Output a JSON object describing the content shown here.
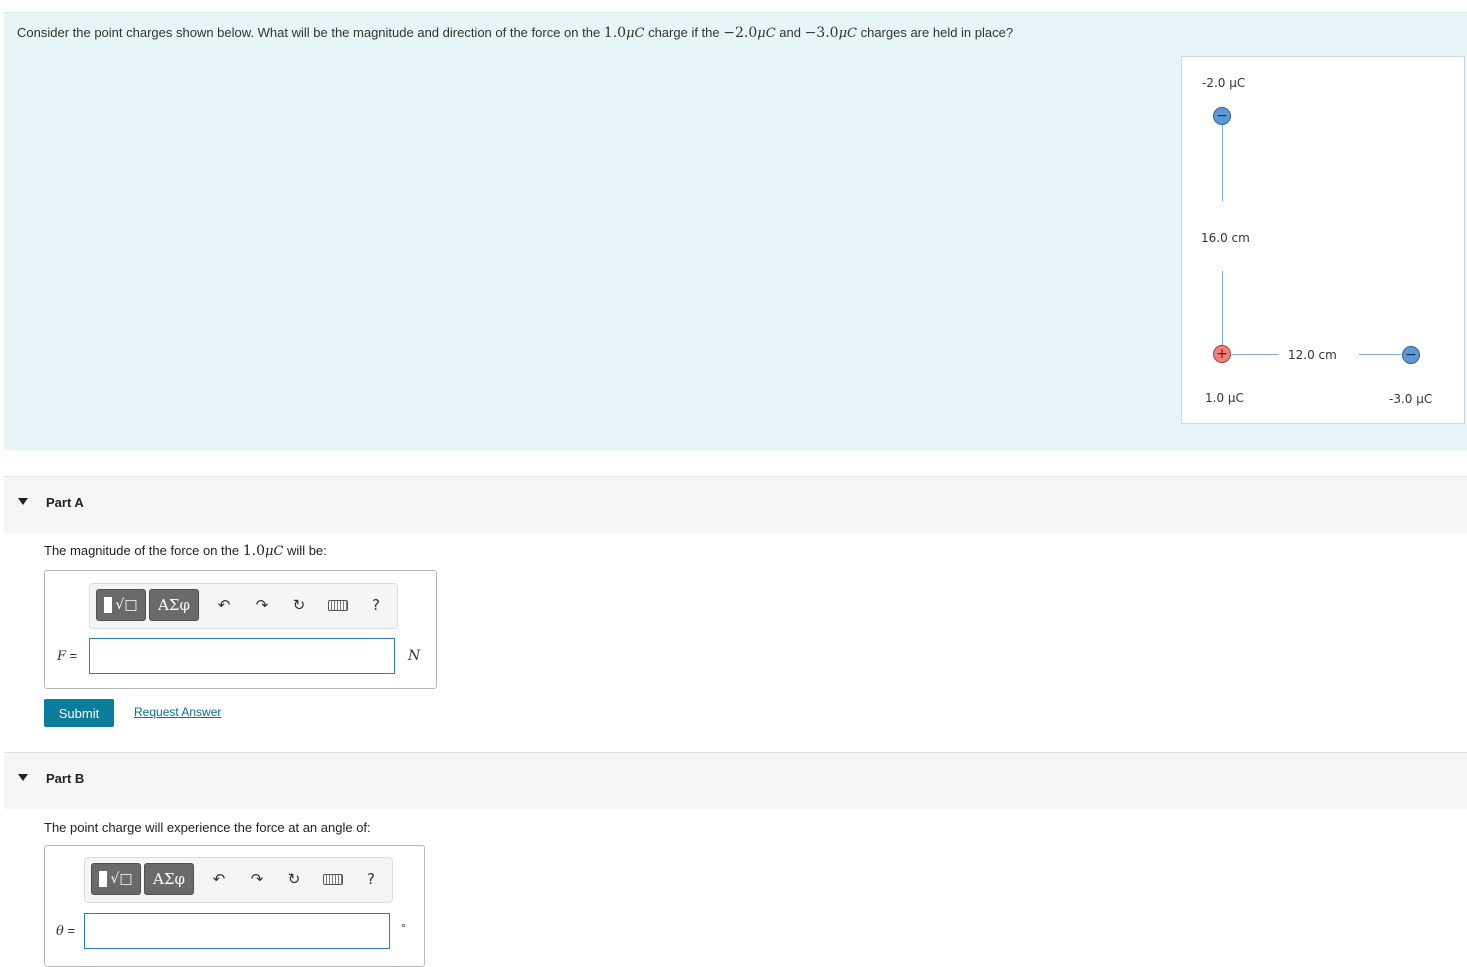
{
  "question": {
    "p1": "Consider the point charges shown below. What will be the magnitude and direction of the force on the ",
    "m1": "1.0",
    "m1u": "μC",
    "p2": " charge if the ",
    "m2": "−2.0",
    "m2u": "μC",
    "p3": " and ",
    "m3": "−3.0",
    "m3u": "μC",
    "p4": " charges are held in place?"
  },
  "figure": {
    "top_charge_label": "-2.0 μC",
    "vertical_distance_label": "16.0 cm",
    "horizontal_distance_label": "12.0 cm",
    "origin_charge_label": "1.0 μC",
    "right_charge_label": "-3.0 μC",
    "neg_symbol": "−",
    "pos_symbol": "+",
    "colors": {
      "negative": "#5b9ad6",
      "positive": "#f08080",
      "line": "#7fb1d6"
    }
  },
  "partA": {
    "title": "Part A",
    "prompt_pre": "The magnitude of the force on the ",
    "prompt_num": "1.0",
    "prompt_unit": "μC",
    "prompt_post": " will be:",
    "var": "F",
    "eq": " =",
    "unit": "N",
    "input_value": "",
    "submit": "Submit",
    "request": "Request Answer"
  },
  "partB": {
    "title": "Part B",
    "prompt": "The point charge will experience the force at an angle of:",
    "var": "θ",
    "eq": " =",
    "unit": "°",
    "input_value": ""
  },
  "toolbar": {
    "templates_icon": "templates-icon",
    "greek_label": "ΑΣφ",
    "undo_icon": "undo-icon",
    "undo_glyph": "↶",
    "redo_icon": "redo-icon",
    "redo_glyph": "↷",
    "reset_icon": "reset-icon",
    "reset_glyph": "↻",
    "keyboard_icon": "keyboard-icon",
    "help_glyph": "?"
  }
}
